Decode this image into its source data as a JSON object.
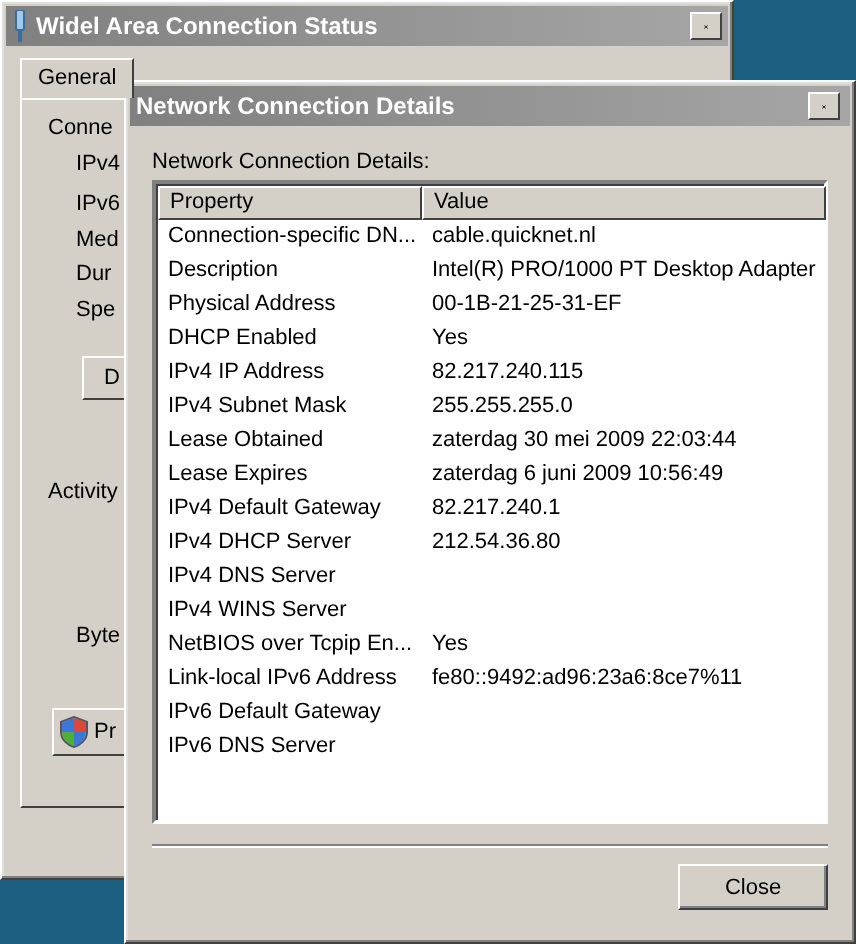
{
  "status_window": {
    "title": "Widel Area Connection Status",
    "tabs": [
      {
        "label": "General",
        "selected": true
      }
    ],
    "items": [
      {
        "kind": "heading",
        "text": "Conne"
      },
      {
        "kind": "field",
        "text": "IPv4"
      },
      {
        "kind": "field",
        "text": "IPv6"
      },
      {
        "kind": "field",
        "text": "Med"
      },
      {
        "kind": "field",
        "text": "Dur"
      },
      {
        "kind": "field",
        "text": "Spe"
      },
      {
        "kind": "button",
        "text": "D"
      },
      {
        "kind": "heading",
        "text": "Activity"
      },
      {
        "kind": "field",
        "text": "Byte"
      },
      {
        "kind": "shield-button",
        "text": "Pr"
      }
    ]
  },
  "details_window": {
    "title": "Network Connection Details",
    "caption": "Network Connection Details:",
    "table": {
      "columns": [
        "Property",
        "Value"
      ],
      "rows": [
        {
          "property": "Connection-specific DN...",
          "value": "cable.quicknet.nl"
        },
        {
          "property": "Description",
          "value": "Intel(R) PRO/1000 PT Desktop Adapter"
        },
        {
          "property": "Physical Address",
          "value": "00-1B-21-25-31-EF"
        },
        {
          "property": "DHCP Enabled",
          "value": "Yes"
        },
        {
          "property": "IPv4 IP Address",
          "value": "82.217.240.115"
        },
        {
          "property": "IPv4 Subnet Mask",
          "value": "255.255.255.0"
        },
        {
          "property": "Lease Obtained",
          "value": "zaterdag 30 mei 2009 22:03:44"
        },
        {
          "property": "Lease Expires",
          "value": "zaterdag 6 juni 2009 10:56:49"
        },
        {
          "property": "IPv4 Default Gateway",
          "value": "82.217.240.1"
        },
        {
          "property": "IPv4 DHCP Server",
          "value": "212.54.36.80"
        },
        {
          "property": "IPv4 DNS Server"
        },
        {
          "property": "IPv4 WINS Server"
        },
        {
          "property": "NetBIOS over Tcpip En...",
          "value": "Yes"
        },
        {
          "property": "Link-local IPv6 Address",
          "value": "fe80::9492:ad96:23a6:8ce7%11"
        },
        {
          "property": "IPv6 Default Gateway"
        },
        {
          "property": "IPv6 DNS Server"
        }
      ]
    },
    "close_button": "Close"
  }
}
